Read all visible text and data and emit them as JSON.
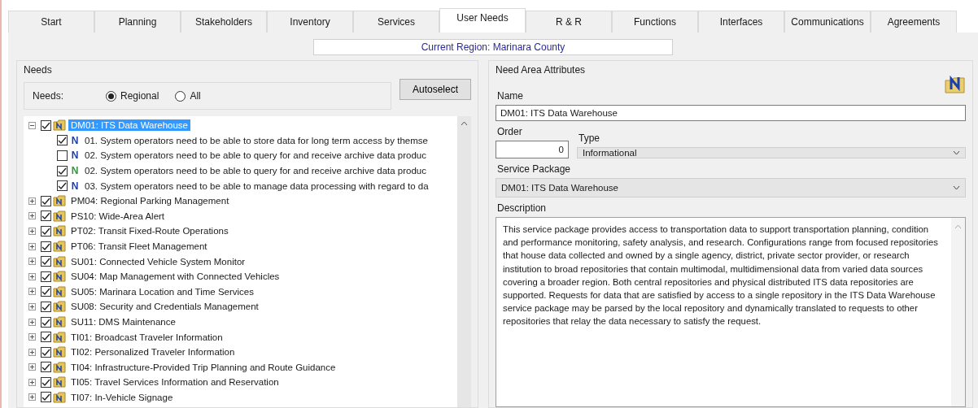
{
  "tabs": [
    {
      "label": "Start",
      "selected": false
    },
    {
      "label": "Planning",
      "selected": false
    },
    {
      "label": "Stakeholders",
      "selected": false
    },
    {
      "label": "Inventory",
      "selected": false
    },
    {
      "label": "Services",
      "selected": false
    },
    {
      "label": "User Needs",
      "selected": true
    },
    {
      "label": "R & R",
      "selected": false
    },
    {
      "label": "Functions",
      "selected": false
    },
    {
      "label": "Interfaces",
      "selected": false
    },
    {
      "label": "Communications",
      "selected": false
    },
    {
      "label": "Agreements",
      "selected": false
    }
  ],
  "current_region": "Current Region: Marinara County",
  "needs": {
    "title": "Needs",
    "filter_label": "Needs:",
    "filter_options": [
      {
        "label": "Regional",
        "selected": true
      },
      {
        "label": "All",
        "selected": false
      }
    ],
    "autoselect_button": "Autoselect",
    "tree": [
      {
        "label": "DM01: ITS Data Warehouse",
        "checked": true,
        "expanded": true,
        "selected": true,
        "children": [
          {
            "letter": "N",
            "color": "#1f3fa8",
            "label": "01. System operators need to be able to store data for long term access by themse",
            "checked": true
          },
          {
            "letter": "N",
            "color": "#1f3fa8",
            "label": "02. System operators need to be able to query for and receive archive data produc",
            "checked": false
          },
          {
            "letter": "N",
            "color": "#2e9a3a",
            "label": "02. System operators need to be able to query for and receive archive data produc",
            "checked": true
          },
          {
            "letter": "N",
            "color": "#1f3fa8",
            "label": "03. System operators need to be able to manage data processing with regard to da",
            "checked": true
          }
        ]
      },
      {
        "label": "PM04: Regional Parking Management",
        "checked": true,
        "expanded": false,
        "selected": false
      },
      {
        "label": "PS10: Wide-Area Alert",
        "checked": true,
        "expanded": false,
        "selected": false
      },
      {
        "label": "PT02: Transit Fixed-Route Operations",
        "checked": true,
        "expanded": false,
        "selected": false
      },
      {
        "label": "PT06: Transit Fleet Management",
        "checked": true,
        "expanded": false,
        "selected": false
      },
      {
        "label": "SU01: Connected Vehicle System Monitor",
        "checked": true,
        "expanded": false,
        "selected": false
      },
      {
        "label": "SU04: Map Management with Connected Vehicles",
        "checked": true,
        "expanded": false,
        "selected": false
      },
      {
        "label": "SU05: Marinara Location and Time Services",
        "checked": true,
        "expanded": false,
        "selected": false
      },
      {
        "label": "SU08: Security and Credentials Management",
        "checked": true,
        "expanded": false,
        "selected": false
      },
      {
        "label": "SU11: DMS Maintenance",
        "checked": true,
        "expanded": false,
        "selected": false
      },
      {
        "label": "TI01: Broadcast Traveler Information",
        "checked": true,
        "expanded": false,
        "selected": false
      },
      {
        "label": "TI02: Personalized Traveler Information",
        "checked": true,
        "expanded": false,
        "selected": false
      },
      {
        "label": "TI04: Infrastructure-Provided Trip Planning and Route Guidance",
        "checked": true,
        "expanded": false,
        "selected": false
      },
      {
        "label": "TI05: Travel Services Information and Reservation",
        "checked": true,
        "expanded": false,
        "selected": false
      },
      {
        "label": "TI07: In-Vehicle Signage",
        "checked": true,
        "expanded": false,
        "selected": false
      }
    ]
  },
  "attributes": {
    "title": "Need Area Attributes",
    "name_label": "Name",
    "name_value": "DM01: ITS Data Warehouse",
    "order_label": "Order",
    "order_value": "0",
    "type_label": "Type",
    "type_value": "Informational",
    "service_package_label": "Service Package",
    "service_package_value": "DM01: ITS Data Warehouse",
    "description_label": "Description",
    "description": "This service package provides access to transportation data to support transportation planning, condition and performance monitoring, safety analysis, and research.  Configurations range from focused repositories that house data collected and owned by a single agency, district, private sector provider, or research institution to broad repositories that contain multimodal, multidimensional data from varied data sources covering a broader region.  Both central repositories and physical distributed ITS data repositories are supported. Requests for data that are satisfied by access to a single repository in the ITS Data Warehouse service package may be parsed by the local repository and dynamically translated to requests to other repositories that relay the data necessary to satisfy the request."
  }
}
